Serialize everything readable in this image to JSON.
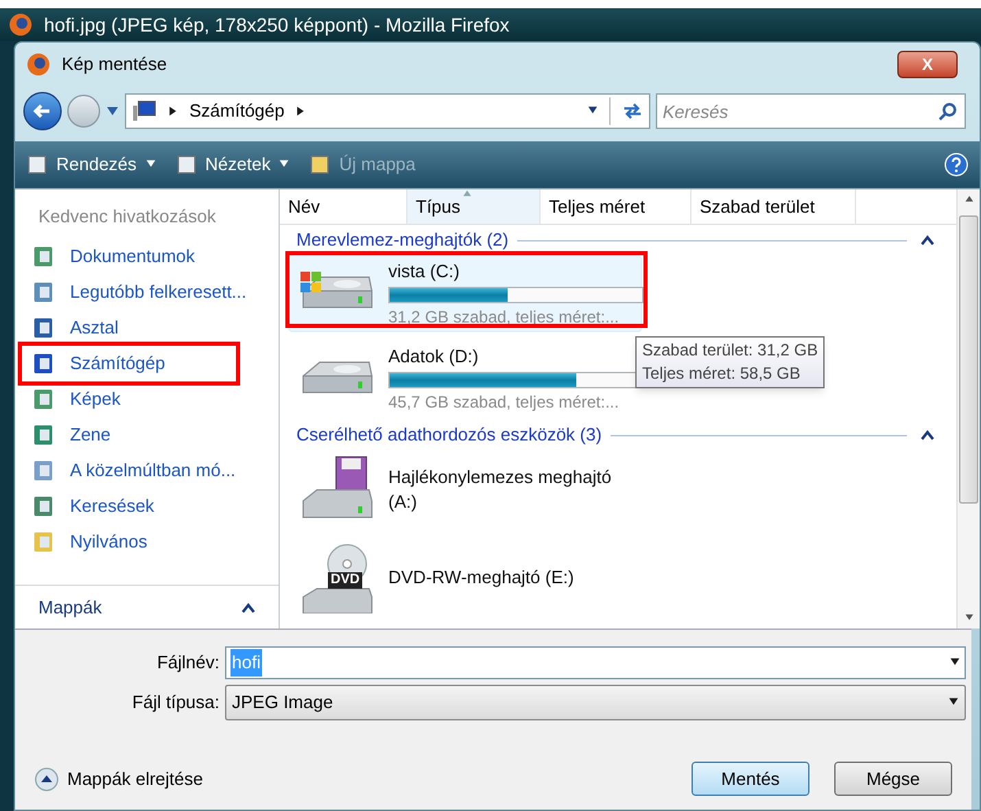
{
  "browser_window": {
    "title": "hofi.jpg (JPEG kép, 178x250 képpont) - Mozilla Firefox"
  },
  "dialog": {
    "title": "Kép mentése",
    "close": "X"
  },
  "address_bar": {
    "path": "Számítógép"
  },
  "search": {
    "placeholder": "Keresés"
  },
  "toolbar": [
    {
      "label": "Rendezés",
      "dropdown": true,
      "disabled": false
    },
    {
      "label": "Nézetek",
      "dropdown": true,
      "disabled": false
    },
    {
      "label": "Új mappa",
      "dropdown": false,
      "disabled": true
    }
  ],
  "sidebar": {
    "heading": "Kedvenc hivatkozások",
    "items": [
      {
        "label": "Dokumentumok",
        "annotated": false
      },
      {
        "label": "Legutóbb felkeresett...",
        "annotated": false
      },
      {
        "label": "Asztal",
        "annotated": false
      },
      {
        "label": "Számítógép",
        "annotated": true
      },
      {
        "label": "Képek",
        "annotated": false
      },
      {
        "label": "Zene",
        "annotated": false
      },
      {
        "label": "A közelmúltban mó...",
        "annotated": false
      },
      {
        "label": "Keresések",
        "annotated": false
      },
      {
        "label": "Nyilvános",
        "annotated": false
      }
    ],
    "folders": {
      "label": "Mappák",
      "expanded": false
    }
  },
  "columns": [
    {
      "label": "Név",
      "sorted": false
    },
    {
      "label": "Típus",
      "sorted": true
    },
    {
      "label": "Teljes méret",
      "sorted": false
    },
    {
      "label": "Szabad terület",
      "sorted": false
    }
  ],
  "groups": [
    {
      "title": "Merevlemez-meghajtók (2)",
      "expanded": true,
      "items": [
        {
          "kind": "system_drive",
          "name": "vista (C:)",
          "level": 0.47,
          "detail": "31,2 GB szabad, teljes méret:...",
          "selected": true,
          "annotated": true
        },
        {
          "kind": "hard_drive",
          "name": "Adatok (D:)",
          "level": 0.74,
          "detail": "45,7 GB szabad, teljes méret:...",
          "selected": false,
          "annotated": false
        }
      ]
    },
    {
      "title": "Cserélhető adathordozós eszközök (3)",
      "expanded": true,
      "items": [
        {
          "kind": "floppy",
          "name": "Hajlékonylemezes meghajtó (A:)",
          "selected": false,
          "annotated": false
        },
        {
          "kind": "dvd",
          "name": "DVD-RW-meghajtó (E:)",
          "label": "DVD",
          "selected": false,
          "annotated": false
        }
      ]
    }
  ],
  "tooltip": [
    "Szabad terület: 31,2 GB",
    "Teljes méret: 58,5 GB"
  ],
  "filename": {
    "label": "Fájlnév:",
    "value": "hofi"
  },
  "filetype": {
    "label": "Fájl típusa:",
    "value": "JPEG Image"
  },
  "hide_folders": {
    "label": "Mappák elrejtése"
  },
  "buttons": [
    {
      "label": "Mentés",
      "default": true
    },
    {
      "label": "Mégse",
      "default": false
    }
  ]
}
